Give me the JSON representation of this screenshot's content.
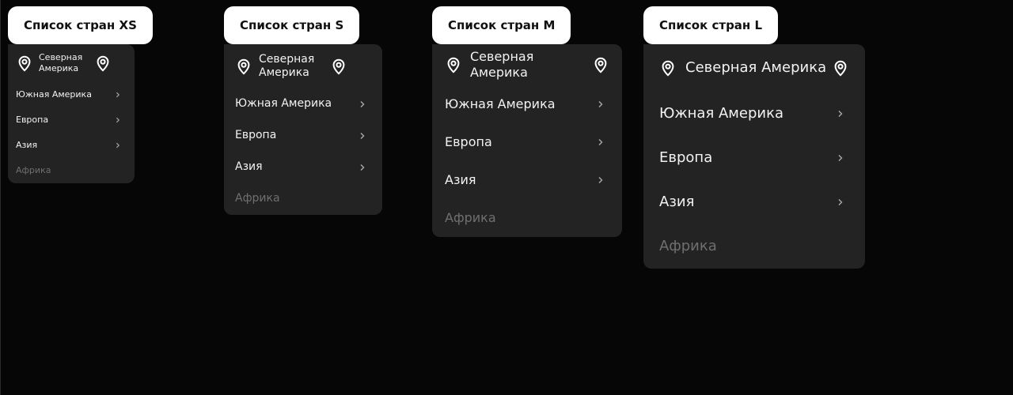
{
  "lists": [
    {
      "title": "Список стран XS",
      "items": [
        {
          "label": "Северная Америка",
          "type": "selected",
          "icon": "map-pin-icon",
          "trailing_icon": "map-pin-icon"
        },
        {
          "label": "Южная Америка",
          "type": "submenu",
          "trailing_icon": "chevron-right-icon"
        },
        {
          "label": "Европа",
          "type": "submenu",
          "trailing_icon": "chevron-right-icon"
        },
        {
          "label": "Азия",
          "type": "submenu",
          "trailing_icon": "chevron-right-icon"
        },
        {
          "label": "Африка",
          "type": "disabled"
        }
      ]
    },
    {
      "title": "Список стран S",
      "items": [
        {
          "label": "Северная Америка",
          "type": "selected",
          "icon": "map-pin-icon",
          "trailing_icon": "map-pin-icon"
        },
        {
          "label": "Южная Америка",
          "type": "submenu",
          "trailing_icon": "chevron-right-icon"
        },
        {
          "label": "Европа",
          "type": "submenu",
          "trailing_icon": "chevron-right-icon"
        },
        {
          "label": "Азия",
          "type": "submenu",
          "trailing_icon": "chevron-right-icon"
        },
        {
          "label": "Африка",
          "type": "disabled"
        }
      ]
    },
    {
      "title": "Список стран M",
      "items": [
        {
          "label": "Северная Америка",
          "type": "selected",
          "icon": "map-pin-icon",
          "trailing_icon": "map-pin-icon"
        },
        {
          "label": "Южная Америка",
          "type": "submenu",
          "trailing_icon": "chevron-right-icon"
        },
        {
          "label": "Европа",
          "type": "submenu",
          "trailing_icon": "chevron-right-icon"
        },
        {
          "label": "Азия",
          "type": "submenu",
          "trailing_icon": "chevron-right-icon"
        },
        {
          "label": "Африка",
          "type": "disabled"
        }
      ]
    },
    {
      "title": "Список стран L",
      "items": [
        {
          "label": "Северная Америка",
          "type": "selected",
          "icon": "map-pin-icon",
          "trailing_icon": "map-pin-icon"
        },
        {
          "label": "Южная Америка",
          "type": "submenu",
          "trailing_icon": "chevron-right-icon"
        },
        {
          "label": "Европа",
          "type": "submenu",
          "trailing_icon": "chevron-right-icon"
        },
        {
          "label": "Азия",
          "type": "submenu",
          "trailing_icon": "chevron-right-icon"
        },
        {
          "label": "Африка",
          "type": "disabled"
        }
      ]
    }
  ],
  "colors": {
    "background": "#060606",
    "menu": "#232323",
    "label_button": "#ffffff",
    "text": "#f2f2f2",
    "disabled_text": "#6f6f6f"
  }
}
